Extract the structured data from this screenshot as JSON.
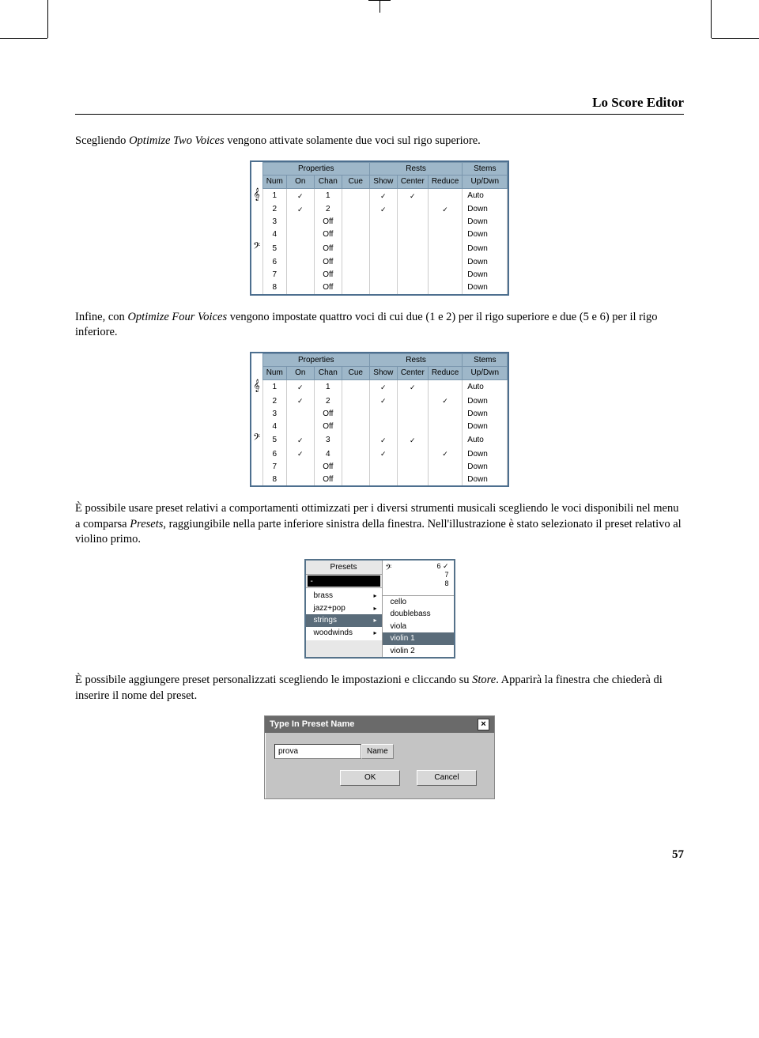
{
  "header": {
    "title": "Lo Score Editor"
  },
  "para1": {
    "pre": "Scegliendo ",
    "em": "Optimize Two Voices",
    "post": " vengono attivate solamente due voci sul rigo superiore."
  },
  "tableHeaders": {
    "groups": [
      "Properties",
      "Rests",
      "Stems"
    ],
    "cols": [
      "Num",
      "On",
      "Chan",
      "Cue",
      "Show",
      "Center",
      "Reduce",
      "Up/Dwn"
    ]
  },
  "table1Rows": [
    {
      "clef": "𝄞",
      "num": "1",
      "on": "✓",
      "chan": "1",
      "cue": "",
      "show": "✓",
      "center": "✓",
      "reduce": "",
      "updown": "Auto"
    },
    {
      "clef": "",
      "num": "2",
      "on": "✓",
      "chan": "2",
      "cue": "",
      "show": "✓",
      "center": "",
      "reduce": "✓",
      "updown": "Down"
    },
    {
      "clef": "",
      "num": "3",
      "on": "",
      "chan": "Off",
      "cue": "",
      "show": "",
      "center": "",
      "reduce": "",
      "updown": "Down"
    },
    {
      "clef": "",
      "num": "4",
      "on": "",
      "chan": "Off",
      "cue": "",
      "show": "",
      "center": "",
      "reduce": "",
      "updown": "Down"
    },
    {
      "clef": "𝄢",
      "num": "5",
      "on": "",
      "chan": "Off",
      "cue": "",
      "show": "",
      "center": "",
      "reduce": "",
      "updown": "Down"
    },
    {
      "clef": "",
      "num": "6",
      "on": "",
      "chan": "Off",
      "cue": "",
      "show": "",
      "center": "",
      "reduce": "",
      "updown": "Down"
    },
    {
      "clef": "",
      "num": "7",
      "on": "",
      "chan": "Off",
      "cue": "",
      "show": "",
      "center": "",
      "reduce": "",
      "updown": "Down"
    },
    {
      "clef": "",
      "num": "8",
      "on": "",
      "chan": "Off",
      "cue": "",
      "show": "",
      "center": "",
      "reduce": "",
      "updown": "Down"
    }
  ],
  "para2": {
    "pre": "Infine, con ",
    "em": "Optimize Four Voices",
    "post": " vengono impostate quattro voci di cui due (1 e 2) per il rigo superiore e due (5 e 6) per il rigo inferiore."
  },
  "table2Rows": [
    {
      "clef": "𝄞",
      "num": "1",
      "on": "✓",
      "chan": "1",
      "cue": "",
      "show": "✓",
      "center": "✓",
      "reduce": "",
      "updown": "Auto"
    },
    {
      "clef": "",
      "num": "2",
      "on": "✓",
      "chan": "2",
      "cue": "",
      "show": "✓",
      "center": "",
      "reduce": "✓",
      "updown": "Down"
    },
    {
      "clef": "",
      "num": "3",
      "on": "",
      "chan": "Off",
      "cue": "",
      "show": "",
      "center": "",
      "reduce": "",
      "updown": "Down"
    },
    {
      "clef": "",
      "num": "4",
      "on": "",
      "chan": "Off",
      "cue": "",
      "show": "",
      "center": "",
      "reduce": "",
      "updown": "Down"
    },
    {
      "clef": "𝄢",
      "num": "5",
      "on": "✓",
      "chan": "3",
      "cue": "",
      "show": "✓",
      "center": "✓",
      "reduce": "",
      "updown": "Auto"
    },
    {
      "clef": "",
      "num": "6",
      "on": "✓",
      "chan": "4",
      "cue": "",
      "show": "✓",
      "center": "",
      "reduce": "✓",
      "updown": "Down"
    },
    {
      "clef": "",
      "num": "7",
      "on": "",
      "chan": "Off",
      "cue": "",
      "show": "",
      "center": "",
      "reduce": "",
      "updown": "Down"
    },
    {
      "clef": "",
      "num": "8",
      "on": "",
      "chan": "Off",
      "cue": "",
      "show": "",
      "center": "",
      "reduce": "",
      "updown": "Down"
    }
  ],
  "para3": {
    "t1": "È possibile usare preset relativi a comportamenti ottimizzati per i diversi strumenti musicali scegliendo le voci disponibili nel menu a comparsa ",
    "em1": "Presets",
    "t2": ", raggiungibile nella parte inferiore sinistra della finestra. Nell'illustrazione è stato selezionato il preset relativo al violino primo."
  },
  "presets": {
    "title": "Presets",
    "selected": "-",
    "menu": [
      "brass",
      "jazz+pop",
      "strings",
      "woodwinds"
    ],
    "menuSelIndex": 2,
    "rightNums": [
      "6   ✓",
      "7",
      "8"
    ],
    "submenu": [
      "cello",
      "doublebass",
      "viola",
      "violin 1",
      "violin 2"
    ],
    "submenuSelIndex": 3
  },
  "para4": {
    "t1": "È possibile aggiungere preset personalizzati scegliendo le impostazioni e cliccando su ",
    "em1": "Store",
    "t2": ". Apparirà la finestra che chiederà di inserire il nome del preset."
  },
  "dialog": {
    "title": "Type In Preset Name",
    "input": "prova",
    "label": "Name",
    "ok": "OK",
    "cancel": "Cancel"
  },
  "pageNumber": "57"
}
